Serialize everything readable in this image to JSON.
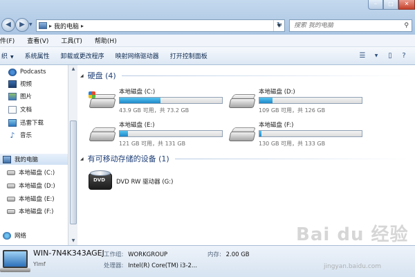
{
  "window": {
    "breadcrumb": [
      "我的电脑"
    ],
    "search_placeholder": "搜索 我的电脑"
  },
  "menu": [
    "文件(F)",
    "查看(V)",
    "工具(T)",
    "帮助(H)"
  ],
  "menu_cut": "件(F)",
  "toolbar": {
    "commands": [
      "组织",
      "系统属性",
      "卸载或更改程序",
      "映射网络驱动器",
      "打开控制面板"
    ],
    "organize_visible": "织"
  },
  "nav": {
    "items": [
      {
        "label": "Podcasts",
        "icon": "podcast-icon"
      },
      {
        "label": "视频",
        "icon": "video-icon"
      },
      {
        "label": "图片",
        "icon": "picture-icon"
      },
      {
        "label": "文档",
        "icon": "document-icon"
      },
      {
        "label": "迅雷下载",
        "icon": "download-icon"
      },
      {
        "label": "音乐",
        "icon": "music-icon"
      }
    ],
    "computer": {
      "label": "我的电脑",
      "icon": "computer-icon"
    },
    "drives": [
      {
        "label": "本地磁盘 (C:)"
      },
      {
        "label": "本地磁盘 (D:)"
      },
      {
        "label": "本地磁盘 (E:)"
      },
      {
        "label": "本地磁盘 (F:)"
      }
    ],
    "network": {
      "label": "网络",
      "icon": "network-icon"
    }
  },
  "groups": {
    "hdd": {
      "title": "硬盘 (4)"
    },
    "removable": {
      "title": "有可移动存储的设备 (1)"
    }
  },
  "drives": [
    {
      "name": "本地磁盘 (C:)",
      "free": "43.9 GB 可用，共 73.2 GB",
      "used_fraction": 0.4
    },
    {
      "name": "本地磁盘 (D:)",
      "free": "109 GB 可用，共 126 GB",
      "used_fraction": 0.13
    },
    {
      "name": "本地磁盘 (E:)",
      "free": "121 GB 可用，共 131 GB",
      "used_fraction": 0.08
    },
    {
      "name": "本地磁盘 (F:)",
      "free": "130 GB 可用，共 133 GB",
      "used_fraction": 0.02
    }
  ],
  "dvd": {
    "name": "DVD RW 驱动器 (G:)",
    "icon_text": "DVD"
  },
  "details": {
    "computer_name": "WIN-7N4K343AGEJ",
    "user": "Ylmf",
    "workgroup_label": "工作组:",
    "workgroup": "WORKGROUP",
    "memory_label": "内存:",
    "memory": "2.00 GB",
    "cpu_label": "处理器:",
    "cpu": "Intel(R) Core(TM) i3-2..."
  },
  "watermark": {
    "logo": "Bai du 经验",
    "url": "jingyan.baidu.com"
  }
}
